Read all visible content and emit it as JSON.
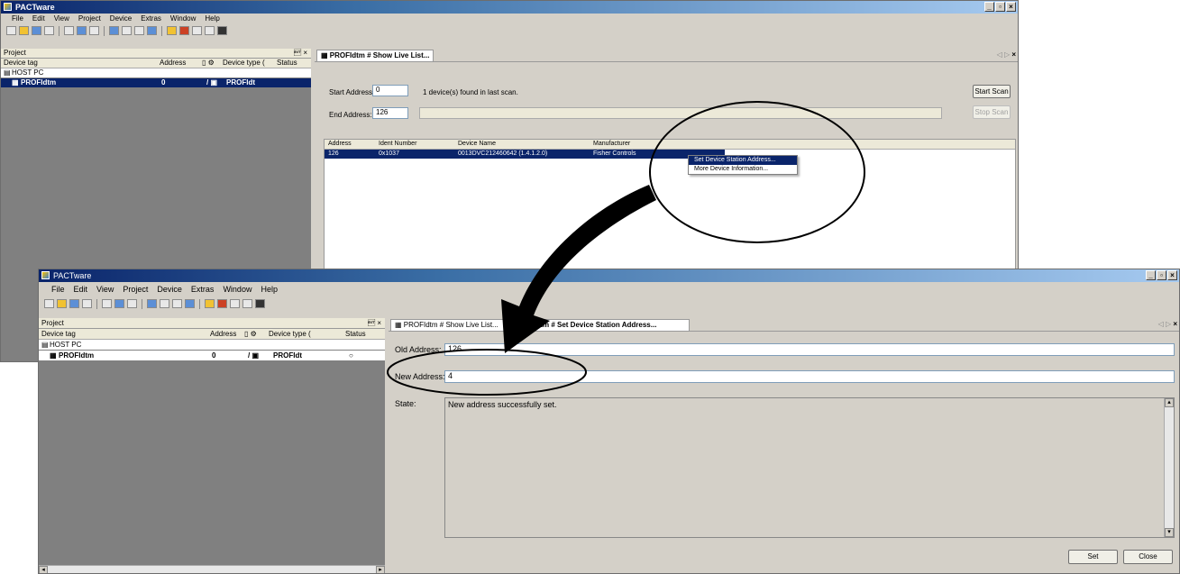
{
  "top_window": {
    "title": "PACTware",
    "menu": [
      "File",
      "Edit",
      "View",
      "Project",
      "Device",
      "Extras",
      "Window",
      "Help"
    ],
    "project_panel": {
      "title": "Project",
      "pin": "\u0004 ×",
      "columns": [
        "Device tag",
        "Address",
        "Device type (",
        "Status"
      ],
      "rows": [
        {
          "tag": "HOST PC",
          "address": "",
          "type": ""
        },
        {
          "tag": "PROFIdtm",
          "address": "0",
          "type": "PROFIdt"
        }
      ]
    },
    "tab_label": "PROFIdtm # Show Live List...",
    "nav": "◁ ▷",
    "close_glyph": "×",
    "start_address_label": "Start Address:",
    "start_address_value": "0",
    "end_address_label": "End Address:",
    "end_address_value": "126",
    "found_text": "1 device(s) found in last scan.",
    "start_scan_button": "Start Scan",
    "stop_scan_button": "Stop Scan",
    "list": {
      "columns": [
        "Address",
        "Ident Number",
        "Device Name",
        "Manufacturer"
      ],
      "rows": [
        {
          "address": "126",
          "ident": "0x1037",
          "name": "0013DVC212460642 (1.4.1.2.0)",
          "manufacturer": "Fisher Controls"
        }
      ]
    },
    "context_menu": [
      "Set Device Station Address...",
      "More Device Information..."
    ]
  },
  "bottom_window": {
    "title": "PACTware",
    "menu": [
      "File",
      "Edit",
      "View",
      "Project",
      "Device",
      "Extras",
      "Window",
      "Help"
    ],
    "project_panel": {
      "title": "Project",
      "pin": "\u0004 ×",
      "columns": [
        "Device tag",
        "Address",
        "Device type (",
        "Status"
      ],
      "rows": [
        {
          "tag": "HOST PC",
          "address": "",
          "type": "",
          "status": ""
        },
        {
          "tag": "PROFIdtm",
          "address": "0",
          "type": "PROFIdt",
          "status": "○"
        }
      ]
    },
    "tabs": [
      "PROFIdtm # Show Live List...",
      "PROFIdtm # Set Device Station Address..."
    ],
    "nav": "◁ ▷",
    "close_glyph": "×",
    "old_address_label": "Old Address:",
    "old_address_value": "126",
    "new_address_label": "New Address:",
    "new_address_value": "4",
    "state_label": "State:",
    "state_text": "New address successfully set.",
    "set_button": "Set",
    "close_button": "Close"
  },
  "colors": {
    "selection": "#0a246a",
    "panel_bg": "#808080",
    "window_bg": "#d4d0c8"
  }
}
